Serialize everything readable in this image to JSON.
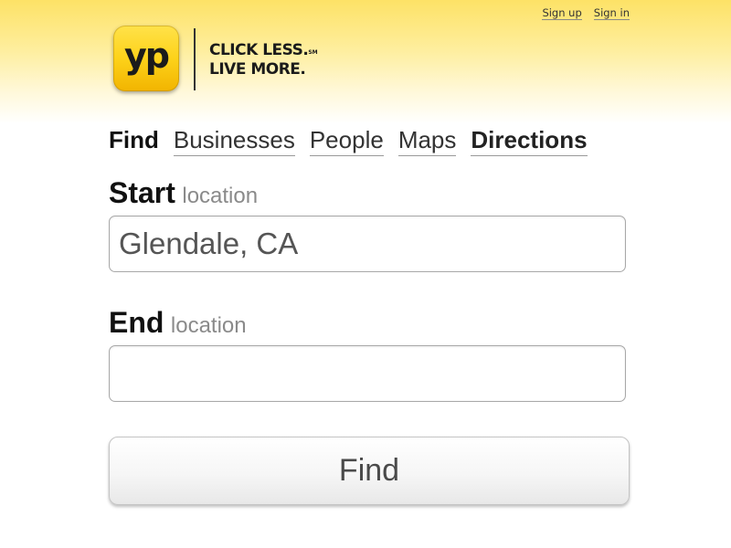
{
  "top_links": {
    "sign_up": "Sign up",
    "sign_in": "Sign in"
  },
  "logo": {
    "text": "yp",
    "tagline_line1": "CLICK LESS.",
    "tagline_mark": "SM",
    "tagline_line2": "LIVE MORE."
  },
  "nav": {
    "find": "Find",
    "items": [
      "Businesses",
      "People",
      "Maps"
    ],
    "directions": "Directions"
  },
  "form": {
    "start_label": "Start",
    "start_sub": "location",
    "start_value": "Glendale, CA",
    "end_label": "End",
    "end_sub": "location",
    "end_value": "",
    "submit_label": "Find"
  },
  "colors": {
    "brand_yellow": "#fdd21a",
    "header_gradient_top": "#fde266"
  }
}
